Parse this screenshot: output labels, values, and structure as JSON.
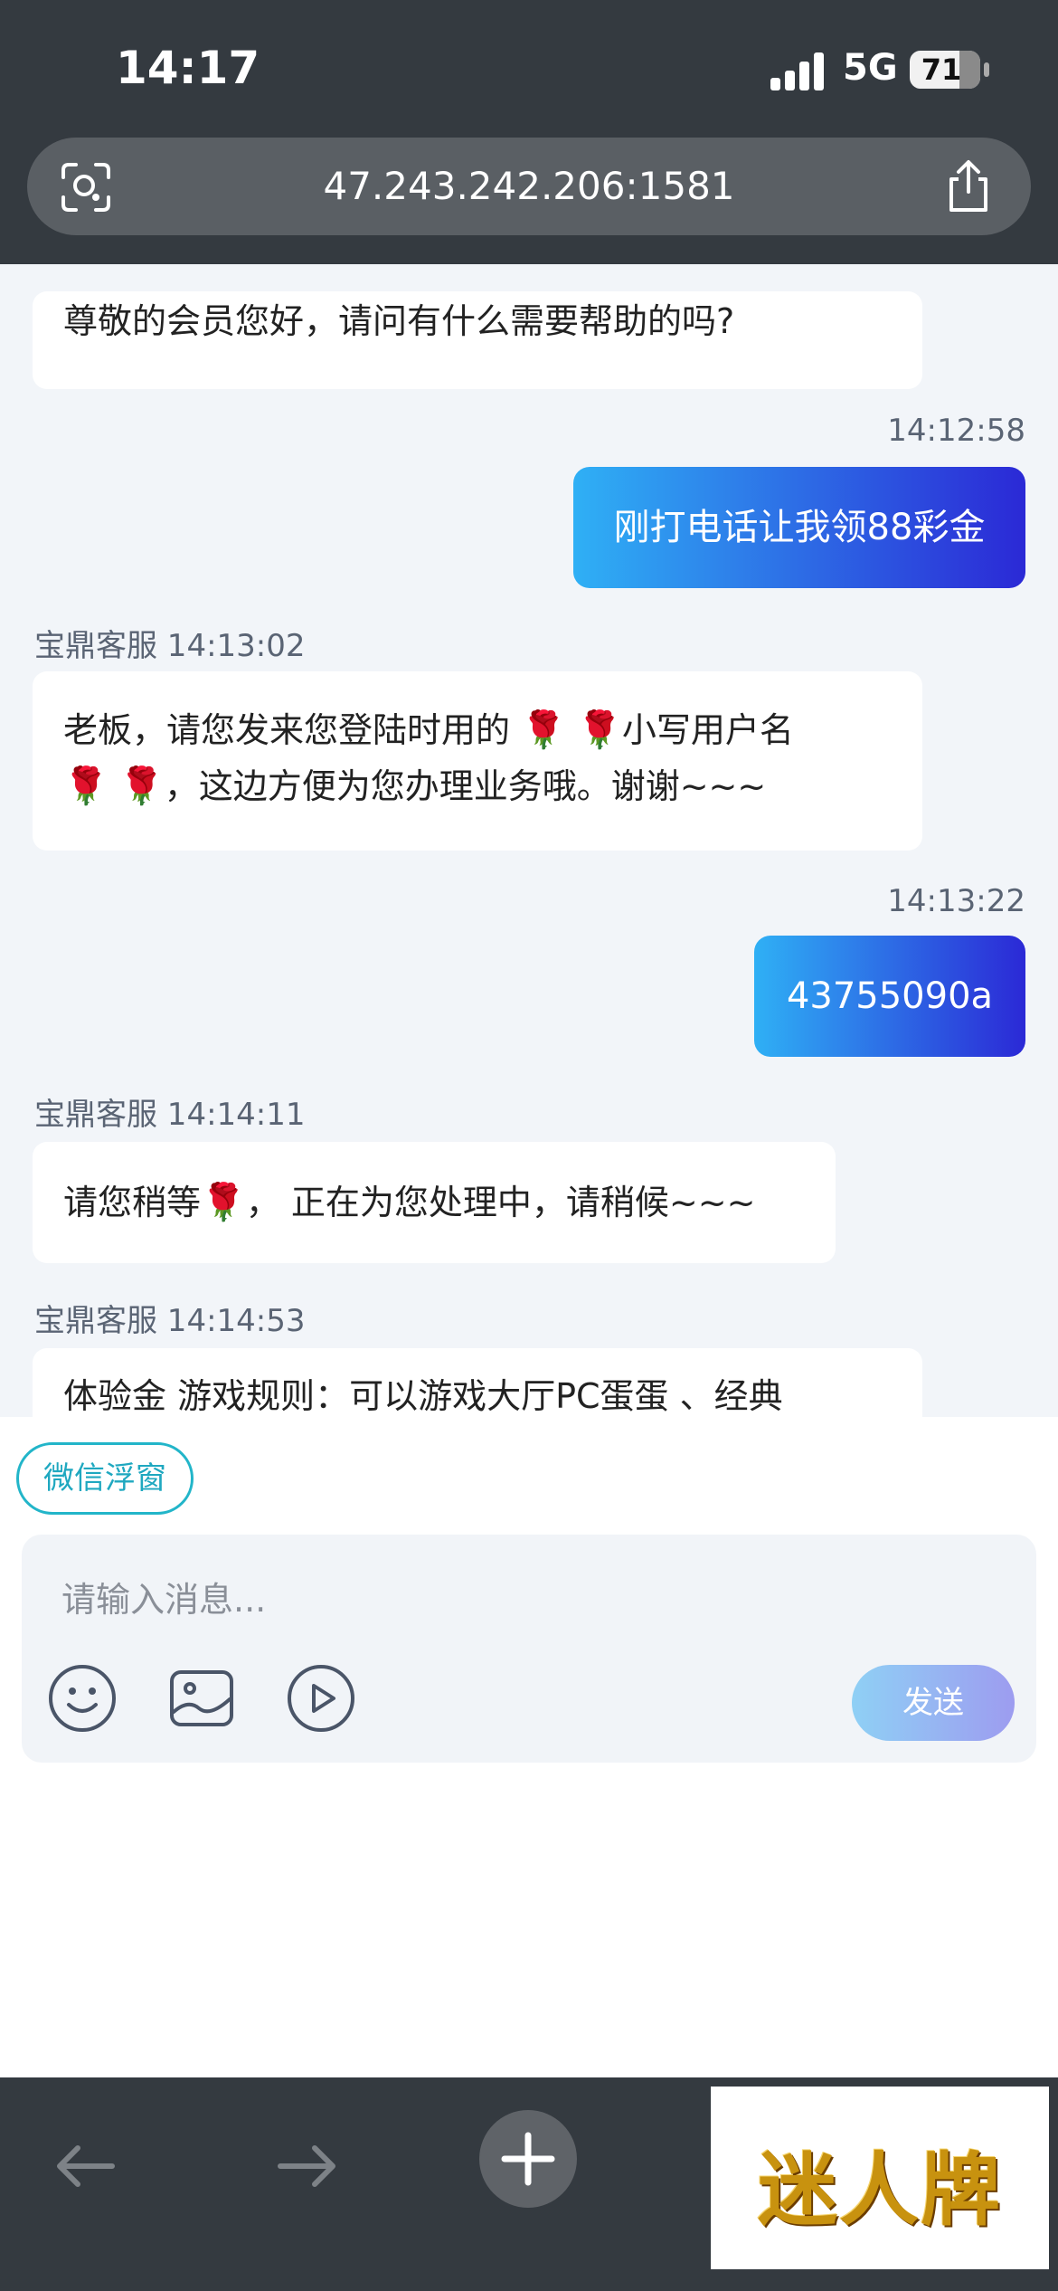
{
  "status_bar": {
    "time": "14:17",
    "network": "5G",
    "battery": "71",
    "battery_level": 0.71
  },
  "browser": {
    "url": "47.243.242.206:1581"
  },
  "messages": [
    {
      "direction": "in",
      "text": "尊敬的会员您好，请问有什么需要帮助的吗?"
    },
    {
      "direction": "out",
      "time": "14:12:58",
      "text": "刚打电话让我领88彩金"
    },
    {
      "direction": "in",
      "sender": "宝鼎客服 14:13:02",
      "line1_a": "老板，请您发来您登陆时用的 ",
      "rose": "🌹",
      "line1_b": "小写用户名",
      "line2": "，这边方便为您办理业务哦。谢谢~~~"
    },
    {
      "direction": "out",
      "time": "14:13:22",
      "text": "43755090a"
    },
    {
      "direction": "in",
      "sender": "宝鼎客服 14:14:11",
      "text_a": "请您稍等",
      "text_b": "，  正在为您处理中，请稍候~~~"
    },
    {
      "direction": "in",
      "sender": "宝鼎客服 14:14:53",
      "text": "体验金 游戏规则：可以游戏大厅PC蛋蛋 、经典"
    }
  ],
  "composer": {
    "wechat_float": "微信浮窗",
    "placeholder": "请输入消息...",
    "send_label": "发送"
  },
  "ad": {
    "text": "迷人牌"
  },
  "colors": {
    "accent_from": "#2fb0f5",
    "accent_to": "#2b29d6",
    "bar": "#343a40",
    "chat_bg": "#f2f5f9"
  }
}
